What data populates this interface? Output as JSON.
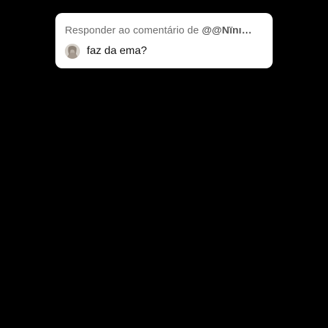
{
  "reply_card": {
    "header_prefix": "Responder ao comentário de ",
    "header_handle": "@@Nïnı…",
    "comment_text": "faz da ema?",
    "avatar_icon": "user-avatar-icon"
  },
  "colors": {
    "background": "#000000",
    "card": "#ffffff",
    "header_text": "#6b6b6b",
    "comment_text": "#111111"
  }
}
